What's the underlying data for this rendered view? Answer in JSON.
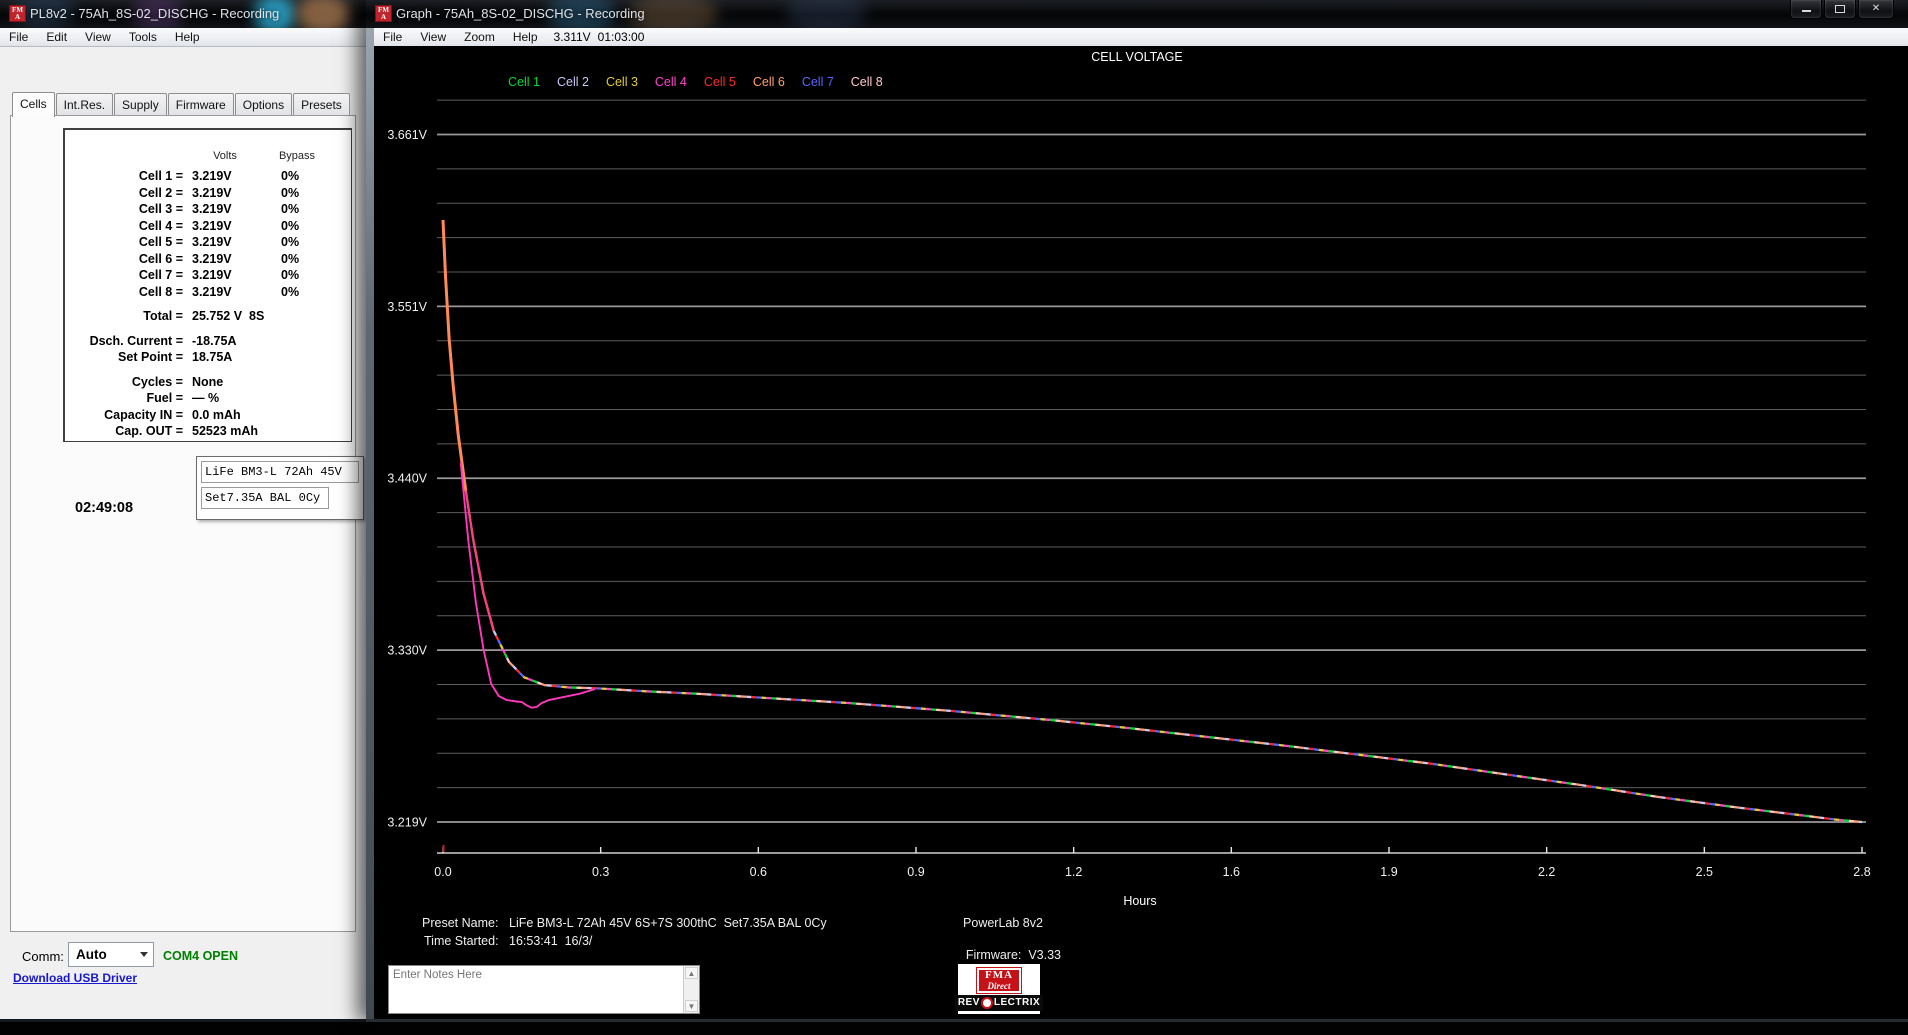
{
  "left_window": {
    "title": "PL8v2 - 75Ah_8S-02_DISCHG - Recording",
    "menu": [
      "File",
      "Edit",
      "View",
      "Tools",
      "Help"
    ],
    "tabs": [
      "Cells",
      "Int.Res.",
      "Supply",
      "Firmware",
      "Options",
      "Presets"
    ],
    "active_tab": "Cells",
    "readout": {
      "volts_header": "Volts",
      "bypass_header": "Bypass",
      "cells": [
        {
          "label": "Cell 1 =",
          "volts": "3.219V",
          "bypass": "0%"
        },
        {
          "label": "Cell 2 =",
          "volts": "3.219V",
          "bypass": "0%"
        },
        {
          "label": "Cell 3 =",
          "volts": "3.219V",
          "bypass": "0%"
        },
        {
          "label": "Cell 4 =",
          "volts": "3.219V",
          "bypass": "0%"
        },
        {
          "label": "Cell 5 =",
          "volts": "3.219V",
          "bypass": "0%"
        },
        {
          "label": "Cell 6 =",
          "volts": "3.219V",
          "bypass": "0%"
        },
        {
          "label": "Cell 7 =",
          "volts": "3.219V",
          "bypass": "0%"
        },
        {
          "label": "Cell 8 =",
          "volts": "3.219V",
          "bypass": "0%"
        }
      ],
      "summary": [
        {
          "label": "Total =",
          "value": "25.752 V  8S",
          "gap": true
        },
        {
          "label": "Dsch. Current =",
          "value": "-18.75A",
          "gap": true
        },
        {
          "label": "Set Point =",
          "value": "18.75A",
          "gap": false
        },
        {
          "label": "Cycles =",
          "value": "None",
          "gap": true
        },
        {
          "label": "Fuel =",
          "value": "— %",
          "gap": false
        },
        {
          "label": "Capacity IN =",
          "value": "0.0 mAh",
          "gap": false
        },
        {
          "label": "Cap. OUT =",
          "value": "52523 mAh",
          "gap": false
        }
      ]
    },
    "timer": "02:49:08",
    "preset_line1": "LiFe BM3-L 72Ah 45V",
    "preset_line2": "Set7.35A BAL 0Cy",
    "comm": {
      "label": "Comm:",
      "selected": "Auto",
      "status": "COM4 OPEN",
      "link": "Download USB Driver"
    }
  },
  "graph_window": {
    "title": "Graph - 75Ah_8S-02_DISCHG - Recording",
    "menu": [
      "File",
      "View",
      "Zoom",
      "Help"
    ],
    "cursor_voltage": "3.311V",
    "cursor_time": "01:03:00",
    "footer": {
      "preset_label": "Preset Name:",
      "preset_value": "LiFe BM3-L 72Ah 45V 6S+7S 300thC  Set7.35A BAL 0Cy",
      "time_label": "Time Started:",
      "time_value": "16:53:41  16/3/",
      "device": "PowerLab 8v2",
      "firmware_label": "Firmware:",
      "firmware_value": "V3.33",
      "notes_placeholder": "Enter Notes Here"
    },
    "logo": {
      "fma": "FMA",
      "direct": "Direct",
      "rev": "REV",
      "lectrix": "LECTRIX"
    }
  },
  "chart_data": {
    "type": "line",
    "title": "CELL VOLTAGE",
    "xlabel": "Hours",
    "x_tick_labels": [
      "0.0",
      "0.3",
      "0.6",
      "0.9",
      "1.2",
      "1.6",
      "1.9",
      "2.2",
      "2.5",
      "2.8"
    ],
    "x_range_hours": [
      0,
      2.8
    ],
    "y_tick_labels": [
      "3.661V",
      "3.551V",
      "3.440V",
      "3.330V",
      "3.219V"
    ],
    "y_tick_values": [
      3.661,
      3.551,
      3.44,
      3.33,
      3.219
    ],
    "ylim": [
      3.219,
      3.683
    ],
    "grid": true,
    "legend_position": "top",
    "legend": [
      {
        "label": "Cell 1",
        "color": "#00dd33"
      },
      {
        "label": "Cell 2",
        "color": "#c9c9fa"
      },
      {
        "label": "Cell 3",
        "color": "#e3cd34"
      },
      {
        "label": "Cell 4",
        "color": "#ff44cc"
      },
      {
        "label": "Cell 5",
        "color": "#ff2a2a"
      },
      {
        "label": "Cell 6",
        "color": "#ffa070"
      },
      {
        "label": "Cell 7",
        "color": "#5a64ff"
      },
      {
        "label": "Cell 8",
        "color": "#ffc9c9"
      }
    ],
    "series_note": "All 8 cell traces overlap within a few mV and render as one multicolor dashed curve; Cell 4 dips slightly below the bundle near the knee.",
    "bundle": {
      "x_hours": [
        0,
        0.005,
        0.012,
        0.02,
        0.03,
        0.045,
        0.06,
        0.08,
        0.1,
        0.13,
        0.16,
        0.2,
        0.25,
        0.3,
        0.4,
        0.5,
        0.6,
        0.7,
        0.8,
        0.9,
        1.0,
        1.1,
        1.2,
        1.35,
        1.5,
        1.65,
        1.8,
        1.95,
        2.1,
        2.25,
        2.4,
        2.55,
        2.65,
        2.75,
        2.8
      ],
      "volts": [
        3.606,
        3.57,
        3.53,
        3.5,
        3.468,
        3.432,
        3.4,
        3.366,
        3.342,
        3.322,
        3.312,
        3.307,
        3.3055,
        3.305,
        3.303,
        3.3015,
        3.2995,
        3.2975,
        3.2955,
        3.293,
        3.2905,
        3.2875,
        3.2845,
        3.2795,
        3.274,
        3.2685,
        3.2625,
        3.2565,
        3.2495,
        3.2425,
        3.235,
        3.2285,
        3.2245,
        3.2205,
        3.219
      ]
    },
    "cell4_deviation": {
      "x_hours": [
        0.035,
        0.05,
        0.065,
        0.08,
        0.095,
        0.11,
        0.125,
        0.145,
        0.155,
        0.165,
        0.175,
        0.185,
        0.195,
        0.21,
        0.24,
        0.27,
        0.3
      ],
      "volts": [
        3.45,
        3.4,
        3.36,
        3.33,
        3.308,
        3.3,
        3.2975,
        3.2965,
        3.2962,
        3.294,
        3.2925,
        3.293,
        3.2955,
        3.2975,
        3.2995,
        3.3015,
        3.3045
      ]
    },
    "dash_colors": [
      "#00dd33",
      "#ff44cc",
      "#e3cd34",
      "#5a64ff",
      "#ff2a2a",
      "#c9c9fa",
      "#ffa070",
      "#ffc9c9"
    ],
    "start_segment_colors": [
      "#ff8a55",
      "#ff3c80"
    ],
    "outlier_color": "#ff38bb",
    "start_marker_color": "#c22222",
    "grid_minor_color": "#5c5c5c",
    "grid_major_color": "#9a9a9a",
    "axis_color": "#cfcfcf"
  }
}
